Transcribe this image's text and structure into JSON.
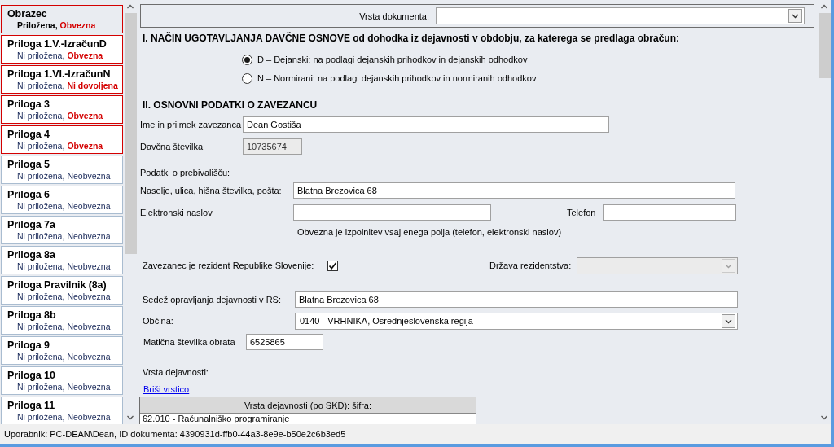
{
  "sidebar": {
    "items": [
      {
        "title": "Obrazec",
        "attached": "Priložena,",
        "status": "Obvezna",
        "required": true,
        "selected": true
      },
      {
        "title": "Priloga 1.V.-IzračunD",
        "attached": "Ni priložena,",
        "status": "Obvezna",
        "required": true,
        "selected": false
      },
      {
        "title": "Priloga 1.VI.-IzračunN",
        "attached": "Ni priložena,",
        "status": "Ni dovoljena",
        "required": true,
        "selected": false
      },
      {
        "title": "Priloga 3",
        "attached": "Ni priložena,",
        "status": "Obvezna",
        "required": true,
        "selected": false
      },
      {
        "title": "Priloga 4",
        "attached": "Ni priložena,",
        "status": "Obvezna",
        "required": true,
        "selected": false
      },
      {
        "title": "Priloga 5",
        "attached": "Ni priložena,",
        "status": "Neobvezna",
        "required": false,
        "selected": false
      },
      {
        "title": "Priloga 6",
        "attached": "Ni priložena,",
        "status": "Neobvezna",
        "required": false,
        "selected": false
      },
      {
        "title": "Priloga 7a",
        "attached": "Ni priložena,",
        "status": "Neobvezna",
        "required": false,
        "selected": false
      },
      {
        "title": "Priloga 8a",
        "attached": "Ni priložena,",
        "status": "Neobvezna",
        "required": false,
        "selected": false
      },
      {
        "title": "Priloga Pravilnik (8a)",
        "attached": "Ni priložena,",
        "status": "Neobvezna",
        "required": false,
        "selected": false
      },
      {
        "title": "Priloga 8b",
        "attached": "Ni priložena,",
        "status": "Neobvezna",
        "required": false,
        "selected": false
      },
      {
        "title": "Priloga 9",
        "attached": "Ni priložena,",
        "status": "Neobvezna",
        "required": false,
        "selected": false
      },
      {
        "title": "Priloga 10",
        "attached": "Ni priložena,",
        "status": "Neobvezna",
        "required": false,
        "selected": false
      },
      {
        "title": "Priloga 11",
        "attached": "Ni priložena,",
        "status": "Neobvezna",
        "required": false,
        "selected": false
      }
    ]
  },
  "document_type": {
    "label": "Vrsta dokumenta:"
  },
  "section_1": {
    "heading": "I.  NAČIN UGOTAVLJANJA DAVČNE OSNOVE od dohodka iz dejavnosti v obdobju, za katerega se predlaga obračun:",
    "options": [
      {
        "label": "D – Dejanski: na podlagi dejanskih prihodkov in dejanskih odhodkov",
        "selected": true
      },
      {
        "label": "N – Normirani: na podlagi dejanskih prihodkov in normiranih odhodkov",
        "selected": false
      }
    ]
  },
  "section_2": {
    "heading": "II. OSNOVNI PODATKI O ZAVEZANCU",
    "name": {
      "label": "Ime in priimek zavezanca",
      "value": "Dean Gostiša"
    },
    "tax_number": {
      "label": "Davčna številka",
      "value": "10735674",
      "disabled": true
    },
    "residence_heading": "Podatki o prebivališču:",
    "address": {
      "label": "Naselje, ulica, hišna številka, pošta:",
      "value": "Blatna Brezovica 68"
    },
    "email": {
      "label": "Elektronski naslov"
    },
    "phone": {
      "label": "Telefon"
    },
    "note": "Obvezna je izpolnitev vsaj enega polja (telefon, elektronski naslov)",
    "resident": {
      "label": "Zavezanec je rezident Republike Slovenije:",
      "checked": true
    },
    "residence_country": {
      "label": "Država rezidentstva:",
      "disabled": true
    },
    "business_seat": {
      "label": "Sedež opravljanja dejavnosti v RS:",
      "value": "Blatna Brezovica 68"
    },
    "municipality": {
      "label": "Občina:",
      "value": "0140 - VRHNIKA, Osrednjeslovenska regija"
    },
    "registration_number": {
      "label": "Matična številka obrata",
      "value": "6525865"
    },
    "activity_heading": "Vrsta dejavnosti:",
    "delete_link": "Briši vrstico",
    "activity_table": {
      "columns": [
        "Vrsta dejavnosti (po SKD): šifra:"
      ],
      "rows": [
        [
          "62.010 - Računalniško programiranje"
        ]
      ]
    }
  },
  "status_bar": "Uporabnik: PC-DEAN\\Dean, ID dokumenta: 4390931d-ffb0-44a3-8e9e-b50e2c6b3ed5"
}
